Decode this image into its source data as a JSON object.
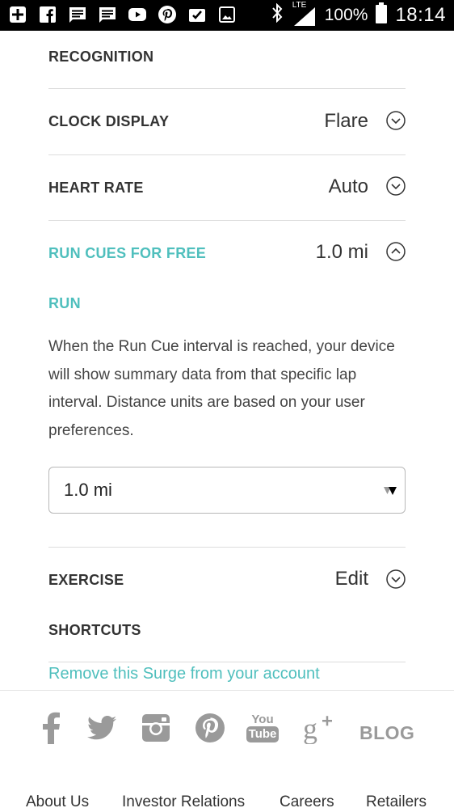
{
  "status_bar": {
    "battery": "100%",
    "time": "18:14",
    "network": "LTE"
  },
  "settings": {
    "recognition_label": "RECOGNITION",
    "clock_display": {
      "label": "CLOCK DISPLAY",
      "value": "Flare"
    },
    "heart_rate": {
      "label": "HEART RATE",
      "value": "Auto"
    },
    "run_cues": {
      "label": "RUN CUES FOR FREE",
      "value": "1.0 mi"
    },
    "run_section": {
      "title": "RUN",
      "description": "When the Run Cue interval is reached, your device will show summary data from that specific lap interval. Distance units are based on your user preferences.",
      "select_value": "1.0 mi"
    },
    "exercise": {
      "label": "EXERCISE",
      "value": "Edit"
    },
    "shortcuts_label": "SHORTCUTS",
    "remove_link": "Remove this Surge from your account"
  },
  "footer": {
    "social": [
      "facebook-icon",
      "twitter-icon",
      "instagram-icon",
      "pinterest-icon",
      "youtube-icon",
      "google-plus-icon"
    ],
    "youtube_top": "You",
    "youtube_bottom": "Tube",
    "blog": "BLOG",
    "links": [
      "About Us",
      "Investor Relations",
      "Careers",
      "Retailers"
    ]
  },
  "colors": {
    "accent": "#4fbfbd",
    "text": "#333333",
    "icon_gray": "#9a9a9a"
  }
}
